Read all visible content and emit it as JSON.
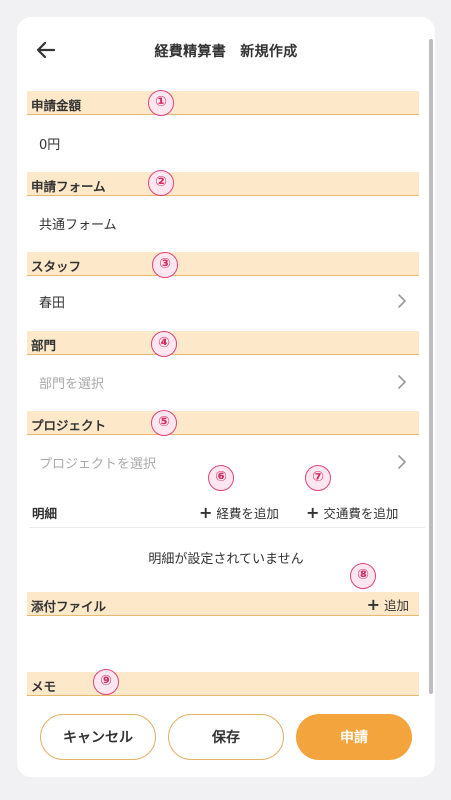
{
  "header": {
    "title": "経費精算書　新規作成",
    "back_icon": "arrow-left-icon"
  },
  "sections": {
    "amount": {
      "label": "申請金額",
      "value": "0円",
      "badge": "①"
    },
    "form": {
      "label": "申請フォーム",
      "value": "共通フォーム",
      "badge": "②"
    },
    "staff": {
      "label": "スタッフ",
      "value": "春田",
      "badge": "③"
    },
    "department": {
      "label": "部門",
      "placeholder": "部門を選択",
      "badge": "④"
    },
    "project": {
      "label": "プロジェクト",
      "placeholder": "プロジェクトを選択",
      "badge": "⑤"
    }
  },
  "details": {
    "label": "明細",
    "add_expense": "経費を追加",
    "add_expense_badge": "⑥",
    "add_transport": "交通費を追加",
    "add_transport_badge": "⑦",
    "empty_message": "明細が設定されていません"
  },
  "attachments": {
    "label": "添付ファイル",
    "add": "追加",
    "badge": "⑧"
  },
  "memo": {
    "label": "メモ",
    "badge": "⑨"
  },
  "footer": {
    "cancel": "キャンセル",
    "save": "保存",
    "submit": "申請"
  },
  "colors": {
    "accent": "#f3a43c",
    "section_bg": "#fde8c9",
    "section_border": "#e9b970",
    "badge": "#e0457b"
  }
}
